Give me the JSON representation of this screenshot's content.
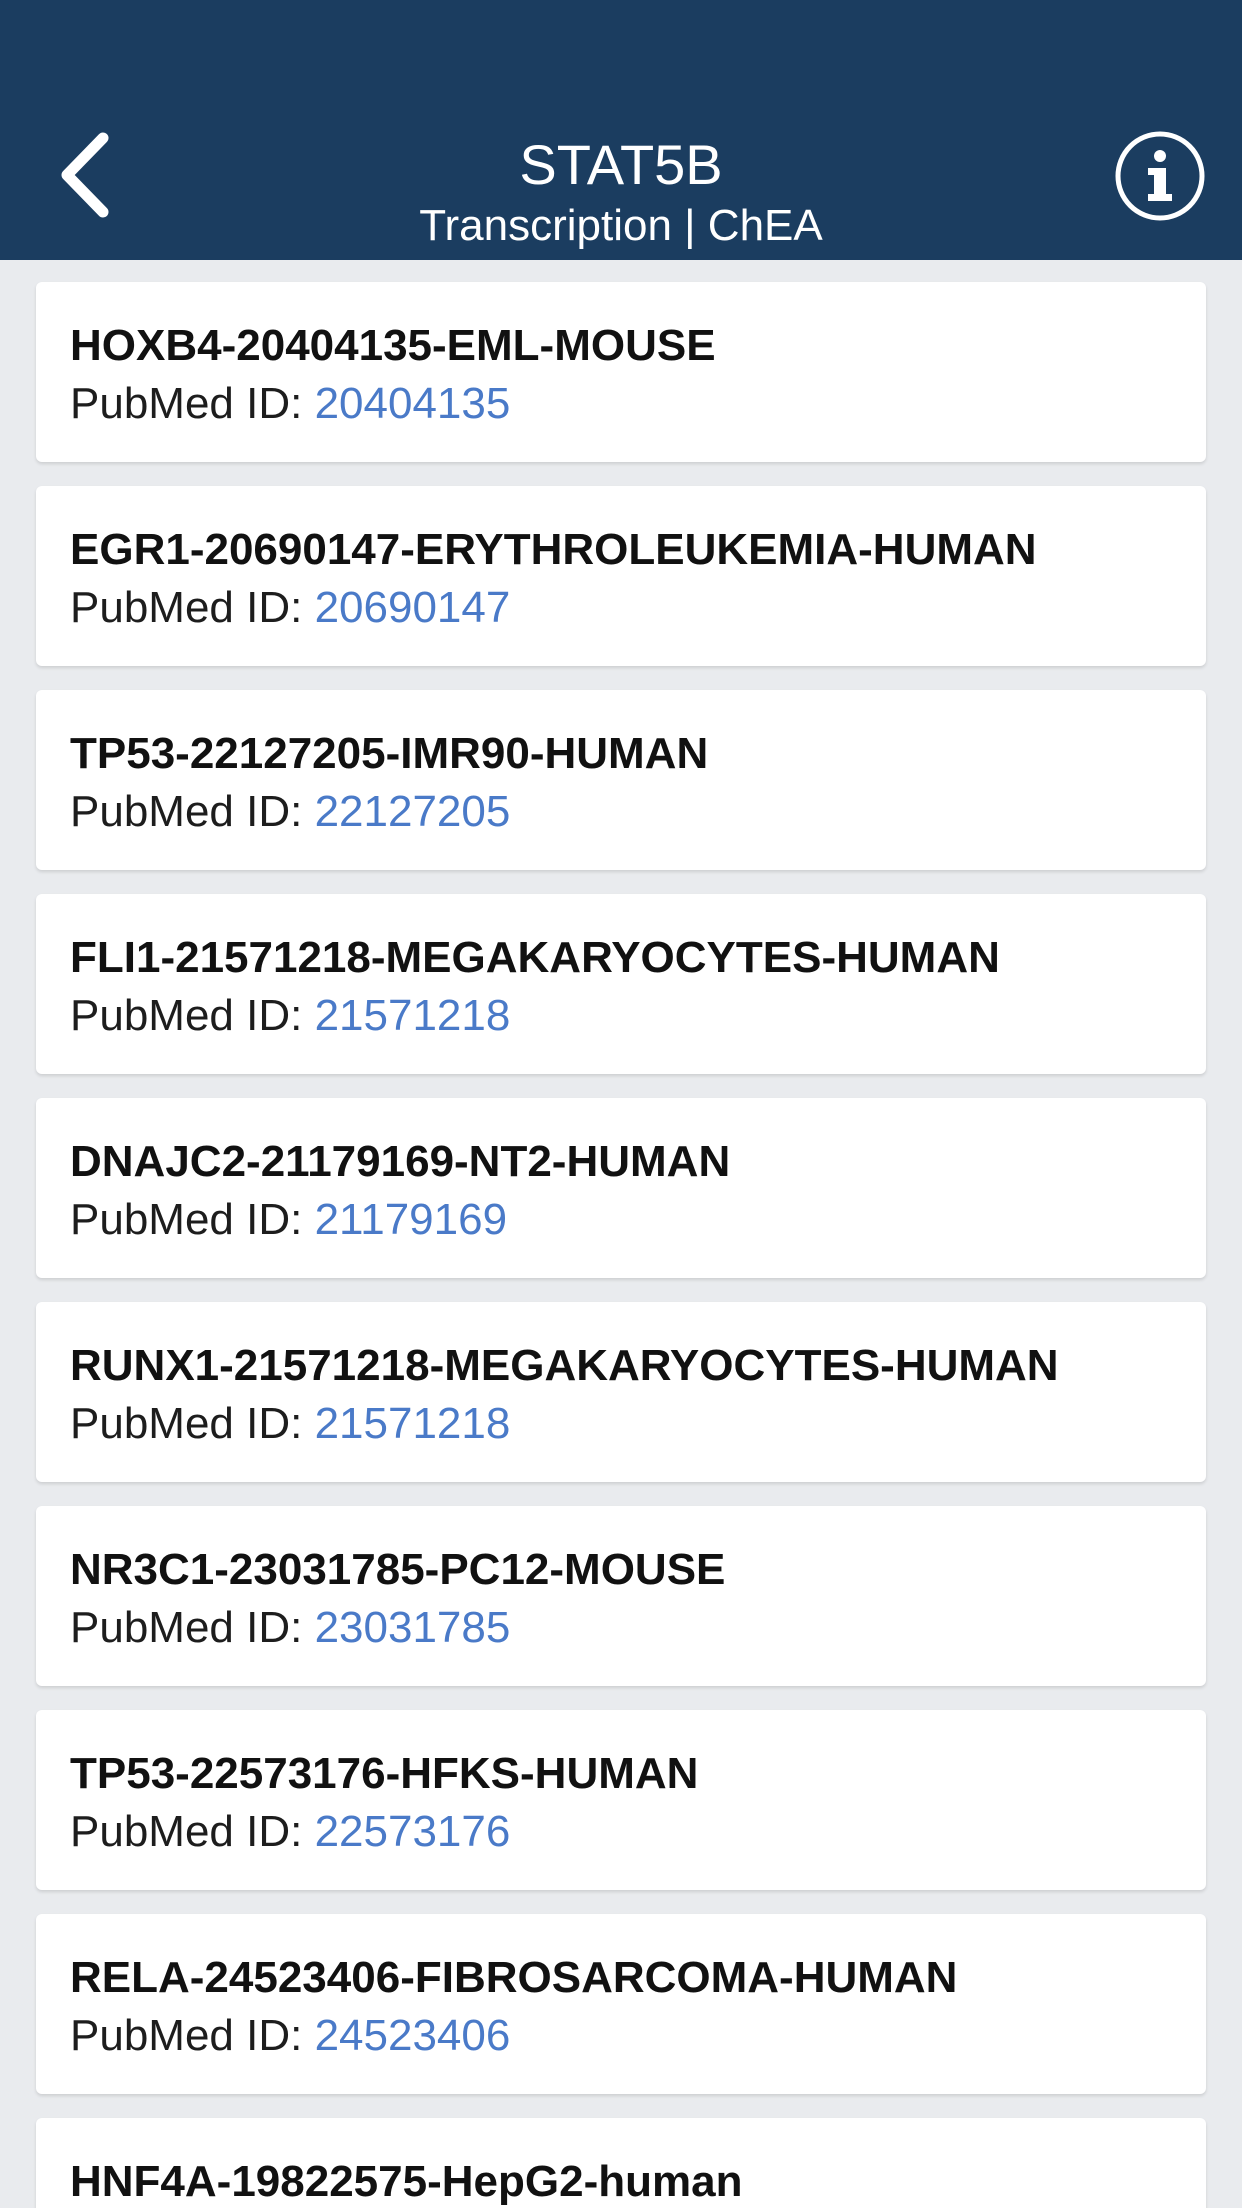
{
  "header": {
    "title": "STAT5B",
    "subtitle": "Transcription | ChEA",
    "back_icon": "chevron-left-icon",
    "info_icon": "info-circle-icon",
    "background_color": "#1b3d60"
  },
  "colors": {
    "link": "#4a7ac8",
    "page_background": "#e9ebee"
  },
  "items": [
    {
      "title": "HOXB4-20404135-EML-MOUSE",
      "pmid_label": "PubMed ID: ",
      "pmid": "20404135"
    },
    {
      "title": "EGR1-20690147-ERYTHROLEUKEMIA-HUMAN",
      "pmid_label": "PubMed ID: ",
      "pmid": "20690147"
    },
    {
      "title": "TP53-22127205-IMR90-HUMAN",
      "pmid_label": "PubMed ID: ",
      "pmid": "22127205"
    },
    {
      "title": "FLI1-21571218-MEGAKARYOCYTES-HUMAN",
      "pmid_label": "PubMed ID: ",
      "pmid": "21571218"
    },
    {
      "title": "DNAJC2-21179169-NT2-HUMAN",
      "pmid_label": "PubMed ID: ",
      "pmid": "21179169"
    },
    {
      "title": "RUNX1-21571218-MEGAKARYOCYTES-HUMAN",
      "pmid_label": "PubMed ID: ",
      "pmid": "21571218"
    },
    {
      "title": "NR3C1-23031785-PC12-MOUSE",
      "pmid_label": "PubMed ID: ",
      "pmid": "23031785"
    },
    {
      "title": "TP53-22573176-HFKS-HUMAN",
      "pmid_label": "PubMed ID: ",
      "pmid": "22573176"
    },
    {
      "title": "RELA-24523406-FIBROSARCOMA-HUMAN",
      "pmid_label": "PubMed ID: ",
      "pmid": "24523406"
    },
    {
      "title": "HNF4A-19822575-HepG2-human",
      "pmid_label": "",
      "pmid": ""
    }
  ]
}
